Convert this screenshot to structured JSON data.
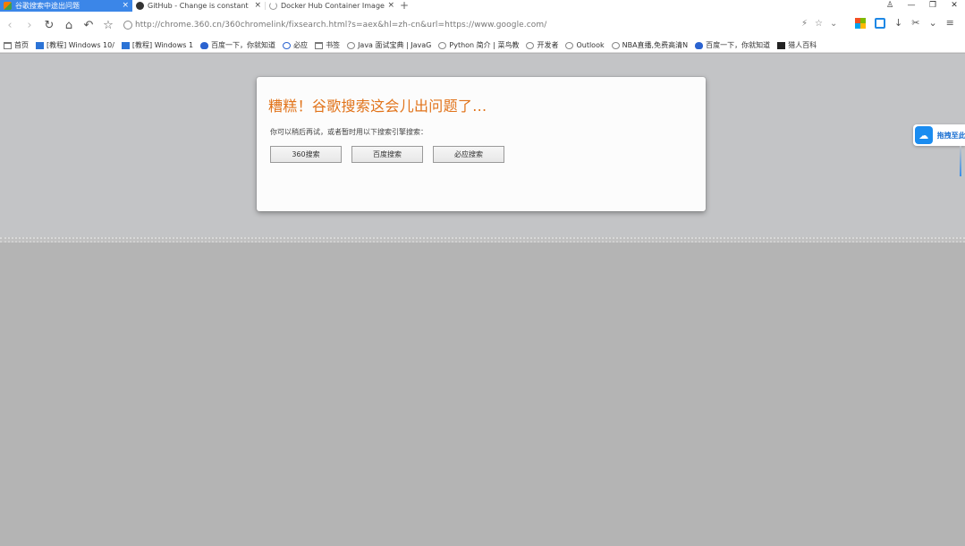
{
  "tabs": [
    {
      "title": "谷歌搜索中途出问题",
      "close": "×",
      "active": true,
      "icon": "favicon"
    },
    {
      "title": "GitHub - Change is constant",
      "close": "×",
      "active": false,
      "icon": "github-icon"
    },
    {
      "title": "Docker Hub Container Image",
      "close": "×",
      "active": false,
      "icon": "loading-icon"
    }
  ],
  "new_tab": "+",
  "window_controls": {
    "shirt": "♙",
    "minimize": "—",
    "restore": "❐",
    "close": "✕"
  },
  "nav": {
    "back": "‹",
    "forward": "›",
    "reload": "↻",
    "home": "⌂",
    "undo": "↶",
    "favorite": "☆"
  },
  "address": {
    "url": "http://chrome.360.cn/360chromelink/fixsearch.html?s=aex&hl=zh-cn&url=https://www.google.com/"
  },
  "url_tools": {
    "bolt": "⚡",
    "star": "☆",
    "dropdown": "⌄"
  },
  "right_tools": {
    "download": "↓",
    "cut": "✂",
    "more": "⌄",
    "menu": "≡"
  },
  "bookmarks": [
    {
      "label": "首页",
      "icon": "folder"
    },
    {
      "label": "[教程] Windows 10/",
      "icon": "blue"
    },
    {
      "label": "[教程] Windows 1",
      "icon": "blue"
    },
    {
      "label": "百度一下，你就知道",
      "icon": "paw"
    },
    {
      "label": "必应",
      "icon": "search"
    },
    {
      "label": "书签",
      "icon": "folder"
    },
    {
      "label": "Java 面试宝典 | JavaG",
      "icon": "globe"
    },
    {
      "label": "Python 简介 | 菜鸟教",
      "icon": "globe"
    },
    {
      "label": "开发者",
      "icon": "globe"
    },
    {
      "label": "Outlook",
      "icon": "globe"
    },
    {
      "label": "NBA直播,免费高清N",
      "icon": "globe"
    },
    {
      "label": "百度一下，你就知道",
      "icon": "paw"
    },
    {
      "label": "猎人百科",
      "icon": "black"
    }
  ],
  "dialog": {
    "title": "糟糕！谷歌搜索这会儿出问题了...",
    "hint": "你可以稍后再试，或者暂时用以下搜索引擎搜索：",
    "buttons": [
      "360搜索",
      "百度搜索",
      "必应搜索"
    ]
  },
  "side_float": {
    "label": "拖拽至此",
    "icon": "cloud-icon"
  },
  "colors": {
    "accent_tab": "#3b86e8",
    "title_orange": "#e1731a",
    "float_blue": "#1a8cf0"
  }
}
